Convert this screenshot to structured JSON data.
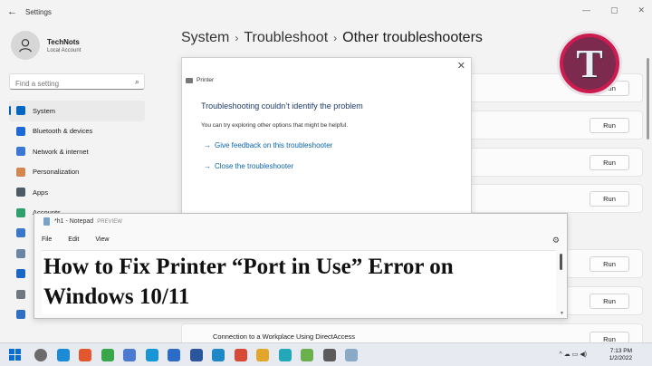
{
  "window": {
    "app_title": "Settings",
    "back": "←",
    "min": "—",
    "max": "▢",
    "close": "✕"
  },
  "user": {
    "name": "TechNots",
    "account": "Local Account"
  },
  "search": {
    "placeholder": "Find a setting",
    "icon": "⌕"
  },
  "nav": {
    "items": [
      {
        "label": "System",
        "color": "#0067c0",
        "active": true
      },
      {
        "label": "Bluetooth & devices",
        "color": "#1c6ad6"
      },
      {
        "label": "Network & internet",
        "color": "#3b78d6"
      },
      {
        "label": "Personalization",
        "color": "#d3864f"
      },
      {
        "label": "Apps",
        "color": "#4c5966"
      },
      {
        "label": "Accounts",
        "color": "#2e9f6d"
      },
      {
        "label": "",
        "color": "#3a78c9"
      },
      {
        "label": "",
        "color": "#6a86a5"
      },
      {
        "label": "",
        "color": "#1b67c7"
      },
      {
        "label": "",
        "color": "#6f7880"
      },
      {
        "label": "",
        "color": "#2f6fc2"
      }
    ]
  },
  "breadcrumb": {
    "part1": "System",
    "sep": "›",
    "part2": "Troubleshoot",
    "part3": "Other troubleshooters"
  },
  "troubleshooters": {
    "run_label": "Run",
    "last_row_label": "Connection to a Workplace Using DirectAccess"
  },
  "dialog": {
    "title": "Printer",
    "close": "✕",
    "heading": "Troubleshooting couldn’t identify the problem",
    "body": "You can try exploring other options that might be helpful.",
    "link1": "Give feedback on this troubleshooter",
    "link2": "Close the troubleshooter",
    "arrow": "→"
  },
  "notepad": {
    "title": "*h1 - Notepad",
    "preview": "PREVIEW",
    "menu": [
      "File",
      "Edit",
      "View"
    ],
    "gear": "⚙",
    "text_line1": "How to Fix Printer “Port in Use” Error on",
    "text_line2": "Windows 10/11"
  },
  "logo": {
    "letter": "T"
  },
  "taskbar": {
    "time": "7:13 PM",
    "date": "1/2/2022",
    "icons": [
      {
        "name": "search",
        "color": "#6b6b6b"
      },
      {
        "name": "edge",
        "color": "#1a8bd6"
      },
      {
        "name": "app-red",
        "color": "#e4572e"
      },
      {
        "name": "app-green",
        "color": "#3aa64a"
      },
      {
        "name": "explorer",
        "color": "#4a7bd0"
      },
      {
        "name": "edge2",
        "color": "#1795d6"
      },
      {
        "name": "store",
        "color": "#2a6cc8"
      },
      {
        "name": "word",
        "color": "#2b579a"
      },
      {
        "name": "photos",
        "color": "#1e88c7"
      },
      {
        "name": "chrome",
        "color": "#d84a38"
      },
      {
        "name": "chrome2",
        "color": "#e1a62a"
      },
      {
        "name": "app-teal",
        "color": "#22a8b6"
      },
      {
        "name": "app-green2",
        "color": "#6ab04c"
      },
      {
        "name": "settings",
        "color": "#5b5b5b"
      },
      {
        "name": "notepad",
        "color": "#8aa9c6"
      }
    ],
    "sys": "^  ☁  ▭  ◀)"
  }
}
